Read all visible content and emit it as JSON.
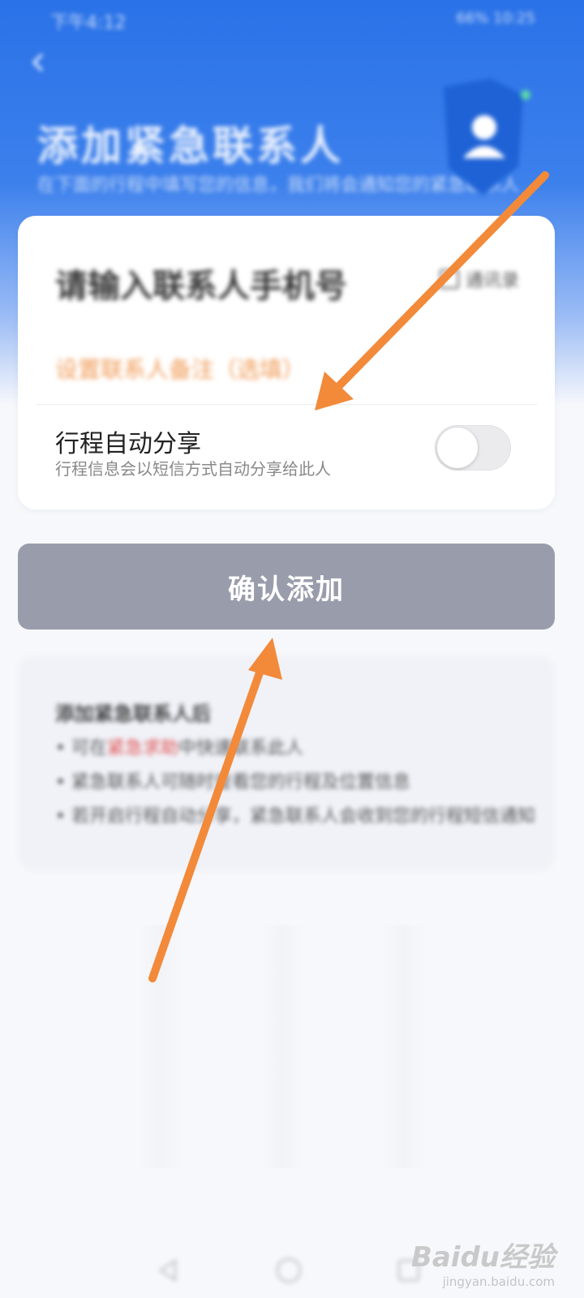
{
  "status_bar": {
    "time": "下午4:12",
    "right": "66%  10:25"
  },
  "header": {
    "title": "添加紧急联系人",
    "subtitle": "在下面的行程中填写您的信息，我们将会通知您的紧急联系人"
  },
  "form": {
    "phone_placeholder": "请输入联系人手机号",
    "contacts_label": "通讯录",
    "remark_placeholder": "设置联系人备注（选填）",
    "auto_share": {
      "title": "行程自动分享",
      "description": "行程信息会以短信方式自动分享给此人",
      "enabled": false
    }
  },
  "confirm_button": {
    "label": "确认添加"
  },
  "notes": {
    "title": "添加紧急联系人后",
    "lines": [
      {
        "prefix": "• 可在",
        "highlight": "紧急求助",
        "suffix": "中快速联系此人"
      },
      {
        "text": "• 紧急联系人可随时查看您的行程及位置信息"
      },
      {
        "text": "• 若开启行程自动分享，紧急联系人会收到您的行程短信通知"
      }
    ]
  },
  "watermark": {
    "logo": "Baidu经验",
    "url": "jingyan.baidu.com"
  },
  "colors": {
    "primary": "#2a72e8",
    "button_disabled": "#999dab",
    "annotation_arrow": "#f28a3a"
  }
}
